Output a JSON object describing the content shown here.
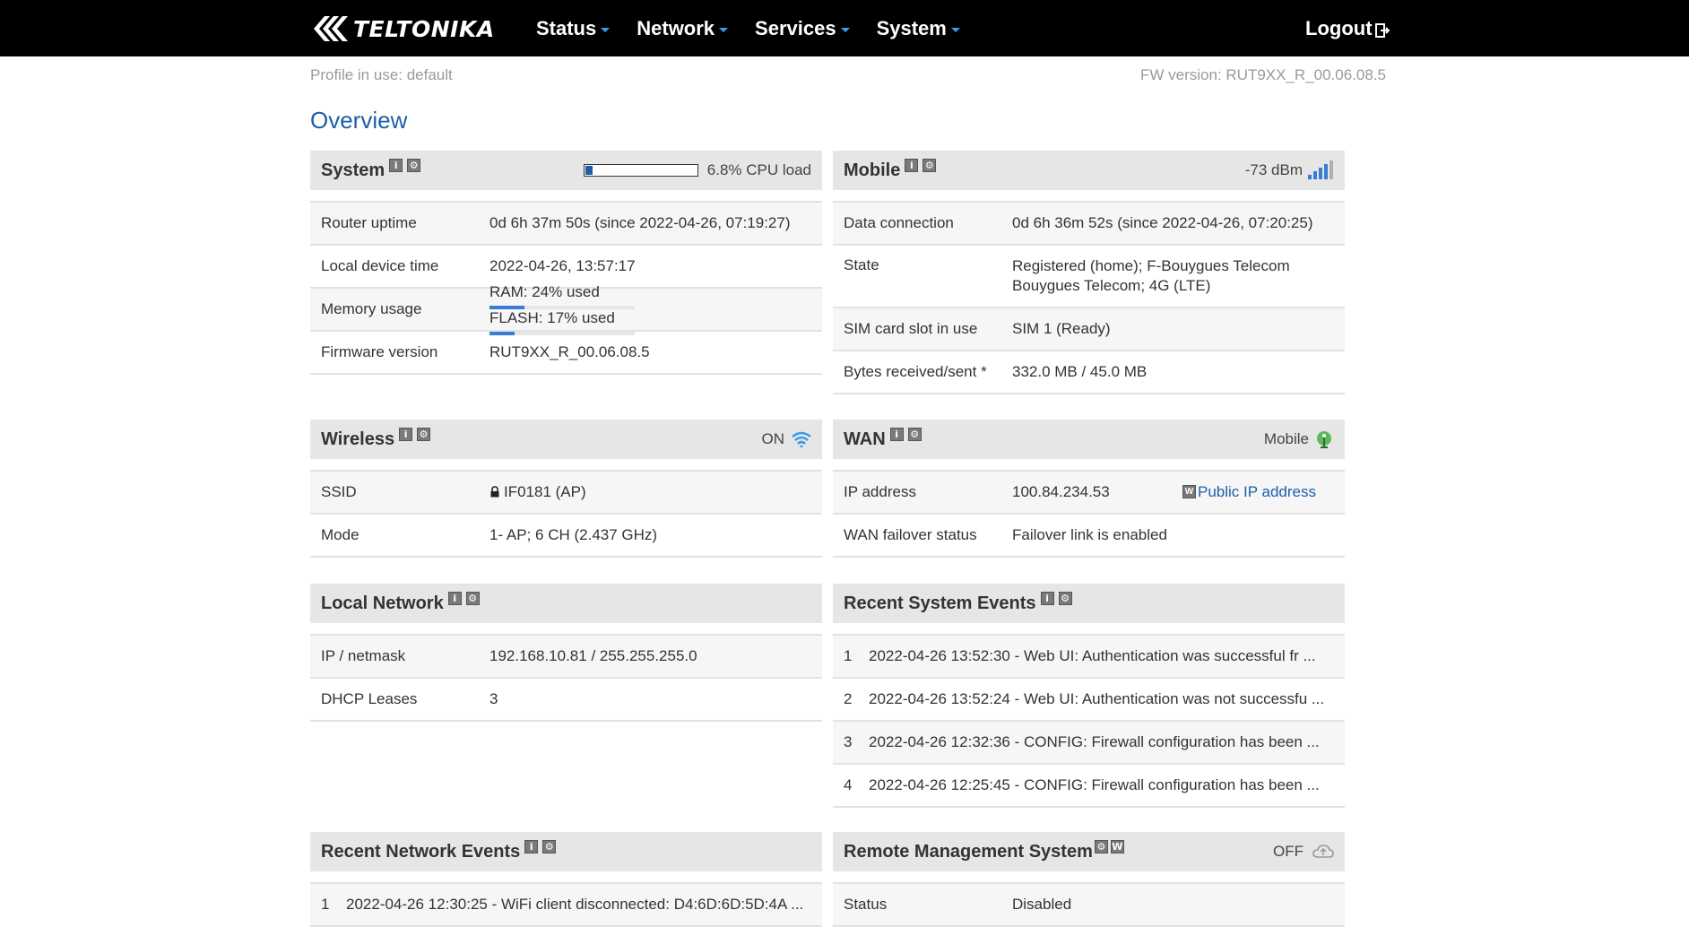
{
  "brand": {
    "name": "TELTONIKA"
  },
  "nav": {
    "status": "Status",
    "network": "Network",
    "services": "Services",
    "system": "System",
    "logout": "Logout"
  },
  "meta": {
    "profile": "Profile in use: default",
    "fw": "FW version: RUT9XX_R_00.06.08.5"
  },
  "page_title": "Overview",
  "system": {
    "title": "System",
    "cpu_load_label": "6.8% CPU load",
    "cpu_load_fraction": 0.068,
    "rows": {
      "uptime_label": "Router uptime",
      "uptime_value": "0d 6h 37m 50s (since 2022-04-26, 07:19:27)",
      "time_label": "Local device time",
      "time_value": "2022-04-26, 13:57:17",
      "memory_label": "Memory usage",
      "ram_label": "RAM: 24% used",
      "flash_label": "FLASH: 17% used",
      "fw_label": "Firmware version",
      "fw_value": "RUT9XX_R_00.06.08.5"
    },
    "ram_fraction": 0.24,
    "flash_fraction": 0.17
  },
  "mobile": {
    "title": "Mobile",
    "signal": "-73 dBm",
    "rows": {
      "data_label": "Data connection",
      "data_value": "0d 6h 36m 52s (since 2022-04-26, 07:20:25)",
      "state_label": "State",
      "state_value_1": "Registered (home); F-Bouygues Telecom",
      "state_value_2": "Bouygues Telecom; 4G (LTE)",
      "sim_label": "SIM card slot in use",
      "sim_value": "SIM 1 (Ready)",
      "bytes_label": "Bytes received/sent *",
      "bytes_value": "332.0 MB / 45.0 MB"
    }
  },
  "wireless": {
    "title": "Wireless",
    "status": "ON",
    "rows": {
      "ssid_label": "SSID",
      "ssid_value": "IF0181 (AP)",
      "mode_label": "Mode",
      "mode_value": "1- AP; 6 CH (2.437 GHz)"
    }
  },
  "wan": {
    "title": "WAN",
    "status": "Mobile",
    "rows": {
      "ip_label": "IP address",
      "ip_value": "100.84.234.53",
      "public_ip": "Public IP address",
      "failover_label": "WAN failover status",
      "failover_value": "Failover link is enabled"
    }
  },
  "lan": {
    "title": "Local Network",
    "rows": {
      "ip_label": "IP / netmask",
      "ip_value": "192.168.10.81 / 255.255.255.0",
      "dhcp_label": "DHCP Leases",
      "dhcp_value": "3"
    }
  },
  "sys_events": {
    "title": "Recent System Events",
    "items": [
      {
        "n": "1",
        "text": "2022-04-26 13:52:30 - Web UI: Authentication was successful fr ..."
      },
      {
        "n": "2",
        "text": "2022-04-26 13:52:24 - Web UI: Authentication was not successfu ..."
      },
      {
        "n": "3",
        "text": "2022-04-26 12:32:36 - CONFIG: Firewall configuration has been ..."
      },
      {
        "n": "4",
        "text": "2022-04-26 12:25:45 - CONFIG: Firewall configuration has been ..."
      }
    ]
  },
  "net_events": {
    "title": "Recent Network Events",
    "items": [
      {
        "n": "1",
        "text": "2022-04-26 12:30:25 - WiFi client disconnected: D4:6D:6D:5D:4A ..."
      }
    ]
  },
  "rms": {
    "title": "Remote Management System",
    "status": "OFF",
    "rows": {
      "status_label": "Status",
      "status_value": "Disabled"
    }
  },
  "icons": {
    "info": "info-icon",
    "settings": "settings-icon",
    "wiki": "W"
  },
  "colors": {
    "accent": "#1d5ea8",
    "caret": "#3b9fe8",
    "header_bg": "#000000",
    "panel_head": "#e6e6e6"
  }
}
